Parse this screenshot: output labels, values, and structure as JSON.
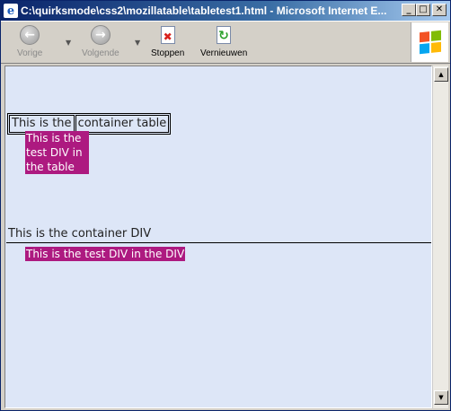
{
  "window": {
    "title": "C:\\quirksmode\\css2\\mozillatable\\tabletest1.html - Microsoft Internet E...",
    "controls": {
      "minimize": "_",
      "maximize": "□",
      "close": "✕"
    }
  },
  "toolbar": {
    "back_label": "Vorige",
    "forward_label": "Volgende",
    "stop_label": "Stoppen",
    "refresh_label": "Vernieuwen"
  },
  "content": {
    "table_cell_1": "This is the",
    "table_cell_2": "container table",
    "test_div_table_lines": [
      "This is the",
      "test DIV in",
      "the table"
    ],
    "container_div": "This is the container DIV",
    "test_div_div": "This is the test DIV in the DIV"
  },
  "colors": {
    "page_background": "#dde6f7",
    "test_div_background": "#ad1a80"
  }
}
